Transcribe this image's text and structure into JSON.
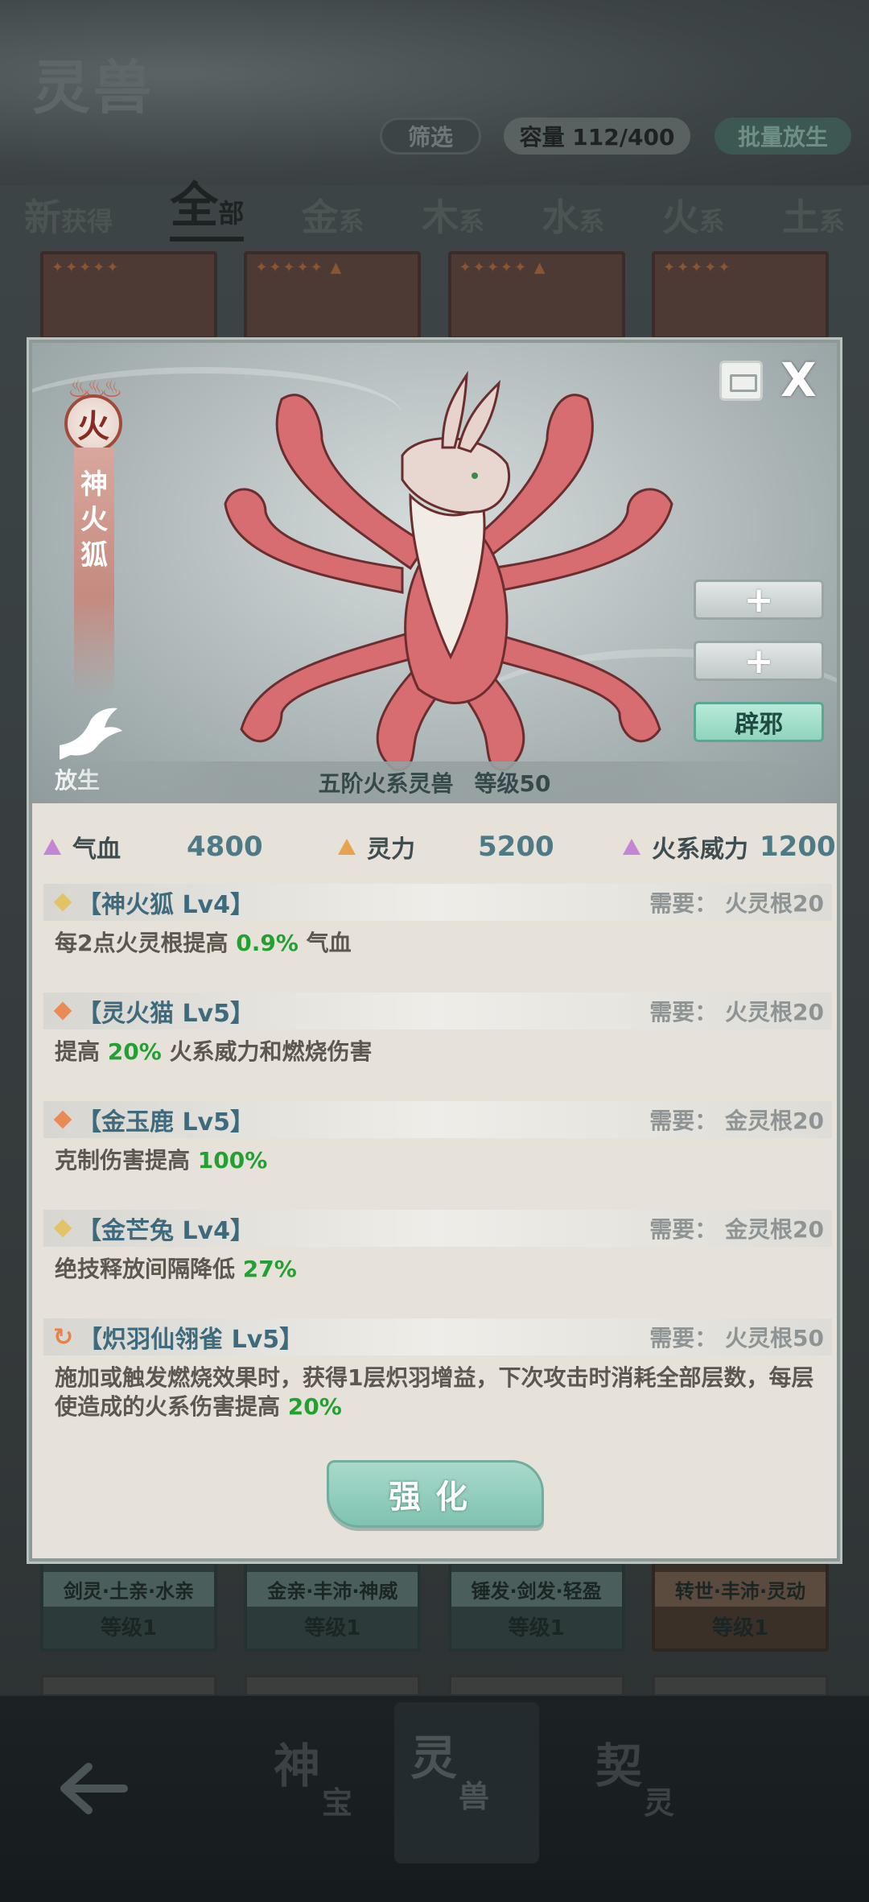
{
  "header": {
    "title": "灵兽",
    "filter_label": "筛选",
    "capacity_label": "容量 112/400",
    "batch_release_label": "批量放生"
  },
  "tabs": [
    {
      "main": "新",
      "sub": "获得"
    },
    {
      "main": "全",
      "sub": "部"
    },
    {
      "main": "金",
      "sub": "系"
    },
    {
      "main": "木",
      "sub": "系"
    },
    {
      "main": "水",
      "sub": "系"
    },
    {
      "main": "火",
      "sub": "系"
    },
    {
      "main": "土",
      "sub": "系"
    }
  ],
  "background_cards": [
    {
      "tags": "剑灵·土亲·水亲",
      "level": "等级1"
    },
    {
      "tags": "金亲·丰沛·神威",
      "level": "等级1"
    },
    {
      "tags": "锤发·剑发·轻盈",
      "level": "等级1"
    },
    {
      "tags": "转世·丰沛·灵动",
      "level": "等级1"
    }
  ],
  "bottom_nav": [
    {
      "main": "神",
      "sub": "宝"
    },
    {
      "main": "灵",
      "sub": "兽"
    },
    {
      "main": "契",
      "sub": "灵"
    }
  ],
  "modal": {
    "element": "火",
    "beast_name_chars": [
      "神",
      "火",
      "狐"
    ],
    "release_label": "放生",
    "close_label": "X",
    "slot_buttons": [
      "+",
      "+",
      "辟邪"
    ],
    "rank_text": "五阶火系灵兽",
    "level_text": "等级50",
    "stats": [
      {
        "label": "气血",
        "value": "4800"
      },
      {
        "label": "灵力",
        "value": "5200"
      },
      {
        "label": "火系威力",
        "value": "1200"
      }
    ],
    "skills": [
      {
        "title": "【神火狐 Lv4】",
        "req": "需要：  火灵根20",
        "desc_pre": "每2点火灵根提高 ",
        "desc_hl": "0.9%",
        "desc_post": " 气血"
      },
      {
        "title": "【灵火猫 Lv5】",
        "req": "需要：  火灵根20",
        "desc_pre": "提高 ",
        "desc_hl": "20%",
        "desc_post": " 火系威力和燃烧伤害"
      },
      {
        "title": "【金玉鹿 Lv5】",
        "req": "需要：  金灵根20",
        "desc_pre": "克制伤害提高 ",
        "desc_hl": "100%",
        "desc_post": ""
      },
      {
        "title": "【金芒兔 Lv4】",
        "req": "需要：  金灵根20",
        "desc_pre": "绝技释放间隔降低 ",
        "desc_hl": "27%",
        "desc_post": ""
      },
      {
        "title": "【炽羽仙翎雀 Lv5】",
        "req": "需要：  火灵根50",
        "desc_pre": "施加或触发燃烧效果时，获得1层炽羽增益，下次攻击时消耗全部层数，每层使造成的火系伤害提高 ",
        "desc_hl": "20%",
        "desc_post": ""
      }
    ],
    "enhance_label": "强化"
  },
  "colors": {
    "accent_green": "#22a032",
    "skill_title": "#3d6a7c",
    "stat_value": "#4e7a86",
    "fire_red": "#8a2a22"
  }
}
